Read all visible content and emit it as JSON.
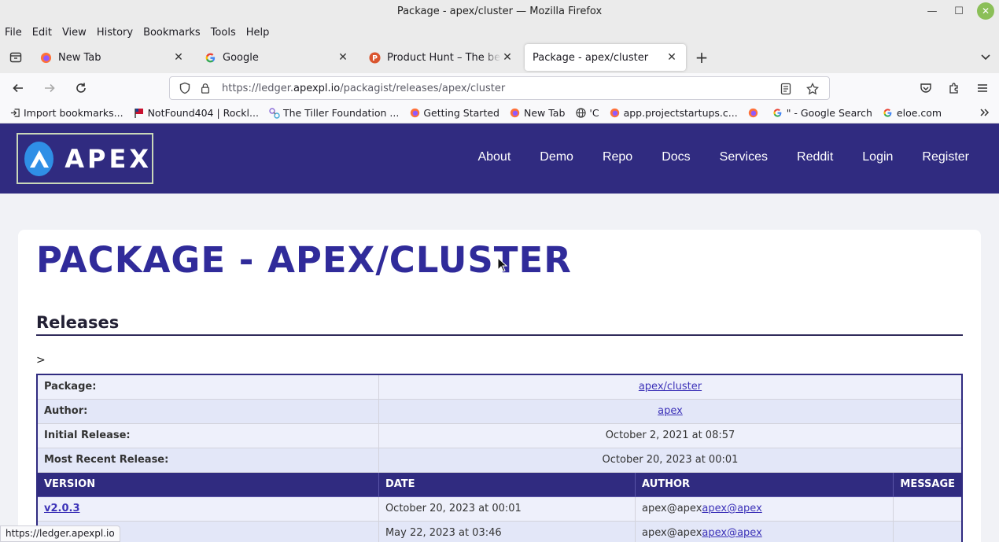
{
  "window": {
    "title": "Package - apex/cluster — Mozilla Firefox"
  },
  "menu": [
    "File",
    "Edit",
    "View",
    "History",
    "Bookmarks",
    "Tools",
    "Help"
  ],
  "tabs": [
    {
      "label": "New Tab",
      "active": false
    },
    {
      "label": "Google",
      "active": false
    },
    {
      "label": "Product Hunt – The best new",
      "active": false
    },
    {
      "label": "Package - apex/cluster",
      "active": true
    }
  ],
  "urlbar": {
    "prefix": "https://ledger.",
    "domain": "apexpl.io",
    "path": "/packagist/releases/apex/cluster"
  },
  "bookmarks": [
    {
      "label": "Import bookmarks...",
      "icon": "import-icon"
    },
    {
      "label": "NotFound404 | Rockl...",
      "icon": "flag-icon"
    },
    {
      "label": "The Tiller Foundation ...",
      "icon": "tiller-icon"
    },
    {
      "label": "Getting Started",
      "icon": "firefox-icon"
    },
    {
      "label": "New Tab",
      "icon": "firefox-icon"
    },
    {
      "label": "'C",
      "icon": "globe-icon"
    },
    {
      "label": "app.projectstartups.c...",
      "icon": "firefox-icon"
    },
    {
      "label": "",
      "icon": "firefox-icon"
    },
    {
      "label": "\" - Google Search",
      "icon": "google-icon"
    },
    {
      "label": "eloe.com",
      "icon": "google-icon"
    }
  ],
  "site": {
    "logo_text": "APEX",
    "nav": [
      "About",
      "Demo",
      "Repo",
      "Docs",
      "Services",
      "Reddit",
      "Login",
      "Register"
    ]
  },
  "main": {
    "title": "PACKAGE - APEX/CLUSTER",
    "section": "Releases",
    "prefix": ">",
    "info": [
      {
        "key": "Package",
        "value": "apex/cluster",
        "link": true
      },
      {
        "key": "Author",
        "value": "apex",
        "link": true
      },
      {
        "key": "Initial Release",
        "value": "October 2, 2021 at 08:57",
        "link": false
      },
      {
        "key": "Most Recent Release",
        "value": "October 20, 2023 at 00:01",
        "link": false
      }
    ],
    "columns": [
      "VERSION",
      "DATE",
      "AUTHOR",
      "MESSAGE"
    ],
    "rows": [
      {
        "version": "v2.0.3",
        "date": "October 20, 2023 at 00:01",
        "author_text": "apex@apex",
        "author_link": "apex@apex",
        "message": ""
      },
      {
        "version": "",
        "date": "May 22, 2023 at 03:46",
        "author_text": "apex@apex",
        "author_link": "apex@apex",
        "message": ""
      }
    ]
  },
  "status": {
    "url": "https://ledger.apexpl.io"
  },
  "colors": {
    "brand": "#302b80",
    "link": "#3c32b8",
    "logo_circle": "#2f8fe6"
  }
}
